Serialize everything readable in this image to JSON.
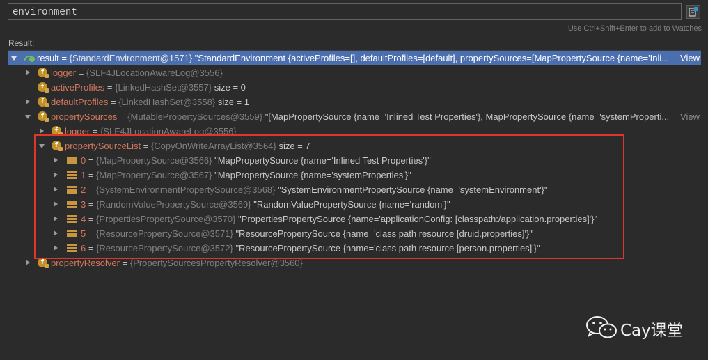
{
  "expression": {
    "value": "environment"
  },
  "hint": "Use Ctrl+Shift+Enter to add to Watches",
  "result_label": "Result:",
  "view_label": "View",
  "rows": [
    {
      "name": "result",
      "sep": " = ",
      "type": "{StandardEnvironment@1571}",
      "value": " \"StandardEnvironment {activeProfiles=[], defaultProfiles=[default], propertySources=[MapPropertySource {name='Inli...",
      "view": true
    },
    {
      "name": "logger",
      "sep": " = ",
      "type": "{SLF4JLocationAwareLog@3556}",
      "value": ""
    },
    {
      "name": "activeProfiles",
      "sep": " = ",
      "type": "{LinkedHashSet@3557}",
      "value": "  size = 0"
    },
    {
      "name": "defaultProfiles",
      "sep": " = ",
      "type": "{LinkedHashSet@3558}",
      "value": "  size = 1"
    },
    {
      "name": "propertySources",
      "sep": " = ",
      "type": "{MutablePropertySources@3559}",
      "value": " \"[MapPropertySource {name='Inlined Test Properties'}, MapPropertySource {name='systemProperti...",
      "view": true
    },
    {
      "name": "logger",
      "sep": " = ",
      "type": "{SLF4JLocationAwareLog@3556}",
      "value": ""
    },
    {
      "name": "propertySourceList",
      "sep": " = ",
      "type": "{CopyOnWriteArrayList@3564}",
      "value": "  size = 7"
    },
    {
      "name": "0",
      "sep": " = ",
      "type": "{MapPropertySource@3566}",
      "value": " \"MapPropertySource {name='Inlined Test Properties'}\""
    },
    {
      "name": "1",
      "sep": " = ",
      "type": "{MapPropertySource@3567}",
      "value": " \"MapPropertySource {name='systemProperties'}\""
    },
    {
      "name": "2",
      "sep": " = ",
      "type": "{SystemEnvironmentPropertySource@3568}",
      "value": " \"SystemEnvironmentPropertySource {name='systemEnvironment'}\""
    },
    {
      "name": "3",
      "sep": " = ",
      "type": "{RandomValuePropertySource@3569}",
      "value": " \"RandomValuePropertySource {name='random'}\""
    },
    {
      "name": "4",
      "sep": " = ",
      "type": "{PropertiesPropertySource@3570}",
      "value": " \"PropertiesPropertySource {name='applicationConfig: [classpath:/application.properties]'}\""
    },
    {
      "name": "5",
      "sep": " = ",
      "type": "{ResourcePropertySource@3571}",
      "value": " \"ResourcePropertySource {name='class path resource [druid.properties]'}\""
    },
    {
      "name": "6",
      "sep": " = ",
      "type": "{ResourcePropertySource@3572}",
      "value": " \"ResourcePropertySource {name='class path resource [person.properties]'}\""
    },
    {
      "name": "propertyResolver",
      "sep": " = ",
      "type": "{PropertySourcesPropertyResolver@3560}",
      "value": ""
    }
  ],
  "watermark": {
    "text": "Cay课堂"
  },
  "colors": {
    "selection": "#4b6eaf",
    "field_name": "#d1785d",
    "highlight_border": "#e0352b",
    "field_icon": "#c29128"
  }
}
